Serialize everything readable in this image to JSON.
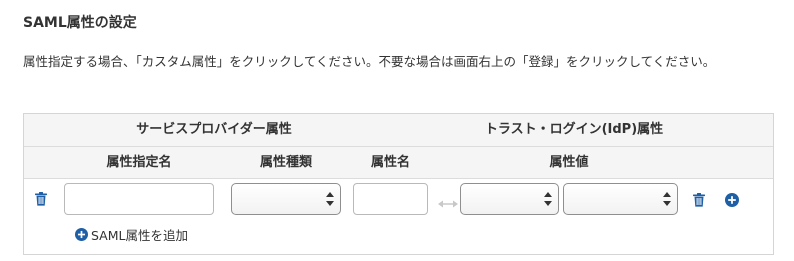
{
  "section": {
    "title": "SAML属性の設定",
    "description": "属性指定する場合、「カスタム属性」をクリックしてください。不要な場合は画面右上の「登録」をクリックしてください。"
  },
  "table": {
    "group_headers": {
      "service_provider": "サービスプロバイダー属性",
      "trust_login": "トラスト・ログイン(IdP)属性"
    },
    "column_headers": {
      "attr_spec_name": "属性指定名",
      "attr_type": "属性種類",
      "attr_name": "属性名",
      "attr_value": "属性値"
    },
    "row": {
      "attr_spec_name_value": "",
      "attr_type_selected": "",
      "attr_name_value": "",
      "attr_value_selected_1": "",
      "attr_value_selected_2": ""
    },
    "add_attribute_label": "SAML属性を追加"
  },
  "icons": {
    "delete": "trash-icon",
    "add": "plus-circle-icon",
    "mapping": "bidirectional-arrow-icon",
    "select": "updown-chevron-icon"
  },
  "colors": {
    "accent": "#1f5fa6",
    "header_bg": "#f5f5f5",
    "border": "#d5d5d5",
    "arrow": "#c8c8c8"
  }
}
